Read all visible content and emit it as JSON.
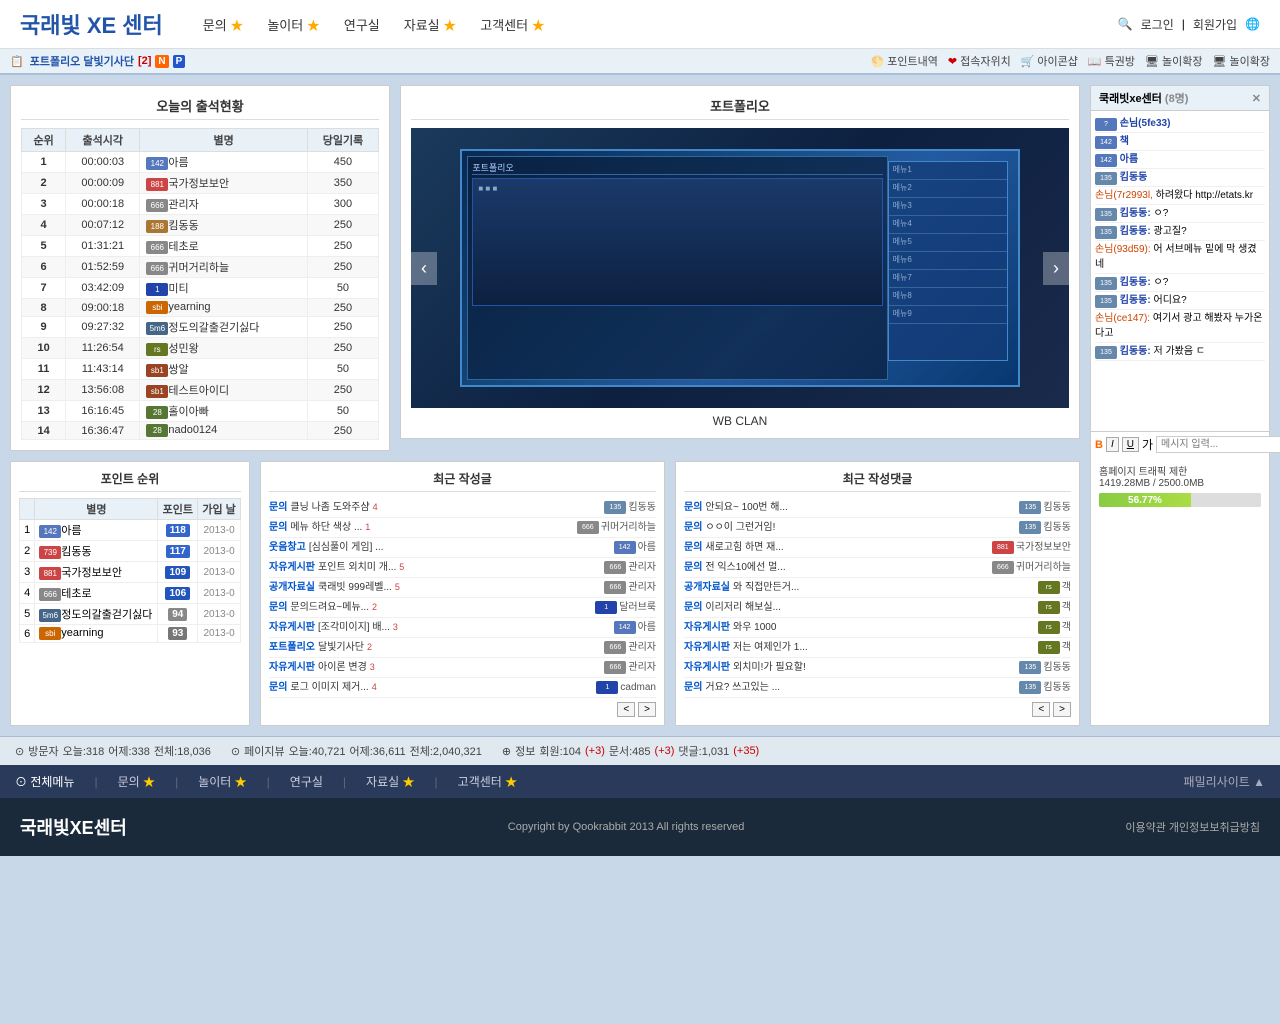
{
  "header": {
    "logo": "국래빛 XE 센터",
    "logo_xe": "XE",
    "nav": [
      {
        "label": "문의",
        "star": true
      },
      {
        "label": "놀이터",
        "star": true
      },
      {
        "label": "연구실",
        "star": false
      },
      {
        "label": "자료실",
        "star": true
      },
      {
        "label": "고객센터",
        "star": true
      }
    ],
    "right": [
      "검색",
      "로그인",
      "회원가입"
    ]
  },
  "tabbar": {
    "title": "포트폴리오 달빛기사단",
    "badge": "[2]",
    "items": [
      {
        "icon": "coin",
        "label": "포인트내역"
      },
      {
        "icon": "heart",
        "label": "접속자위치"
      },
      {
        "icon": "shop",
        "label": "아이콘샵"
      },
      {
        "icon": "book",
        "label": "특권방"
      },
      {
        "icon": "expand",
        "label": "놀이확장"
      },
      {
        "icon": "expand2",
        "label": "놀이확장"
      }
    ]
  },
  "attendance": {
    "title": "오늘의 출석현황",
    "headers": [
      "순위",
      "출석시각",
      "별명",
      "당일기록"
    ],
    "rows": [
      {
        "rank": "1",
        "time": "00:00:03",
        "badge": "142",
        "name": "아름",
        "score": "450"
      },
      {
        "rank": "2",
        "time": "00:00:09",
        "badge": "881",
        "name": "국가정보보안",
        "score": "350"
      },
      {
        "rank": "3",
        "time": "00:00:18",
        "badge": "666",
        "name": "관리자",
        "score": "300"
      },
      {
        "rank": "4",
        "time": "00:07:12",
        "badge": "188",
        "name": "킴동동",
        "score": "250"
      },
      {
        "rank": "5",
        "time": "01:31:21",
        "badge": "666",
        "name": "테초로",
        "score": "250"
      },
      {
        "rank": "6",
        "time": "01:52:59",
        "badge": "666",
        "name": "귀머거리하늘",
        "score": "250"
      },
      {
        "rank": "7",
        "time": "03:42:09",
        "badge": "1",
        "name": "미티",
        "score": "50"
      },
      {
        "rank": "8",
        "time": "09:00:18",
        "badge": "sbi",
        "name": "yearning",
        "score": "250"
      },
      {
        "rank": "9",
        "time": "09:27:32",
        "badge": "5m6",
        "name": "정도의갈출걷기싫다",
        "score": "250"
      },
      {
        "rank": "10",
        "time": "11:26:54",
        "badge": "rs",
        "name": "성민왕",
        "score": "250"
      },
      {
        "rank": "11",
        "time": "11:43:14",
        "badge": "sb1",
        "name": "쌍알",
        "score": "50"
      },
      {
        "rank": "12",
        "time": "13:56:08",
        "badge": "sb1",
        "name": "테스트아이디",
        "score": "250"
      },
      {
        "rank": "13",
        "time": "16:16:45",
        "badge": "28",
        "name": "홀이아빠",
        "score": "50"
      },
      {
        "rank": "14",
        "time": "16:36:47",
        "badge": "28",
        "name": "nado0124",
        "score": "250"
      }
    ]
  },
  "portfolio": {
    "title": "포트폴리오",
    "caption": "WB CLAN"
  },
  "points_ranking": {
    "title": "포인트 순위",
    "headers": [
      "별명",
      "포인트",
      "가입 날"
    ],
    "rows": [
      {
        "rank": "1",
        "badge": "142",
        "name": "아름",
        "points": "118",
        "date": "2013-0"
      },
      {
        "rank": "2",
        "badge": "739",
        "name": "킴동동",
        "points": "117",
        "date": "2013-0"
      },
      {
        "rank": "3",
        "badge": "881",
        "name": "국가정보보안",
        "points": "109",
        "date": "2013-0"
      },
      {
        "rank": "4",
        "badge": "666",
        "name": "테초로",
        "points": "106",
        "date": "2013-0"
      },
      {
        "rank": "5",
        "badge": "5m6",
        "name": "정도의갈출걷기싫다",
        "points": "94",
        "date": "2013-0"
      },
      {
        "rank": "6",
        "badge": "sbi",
        "name": "yearning",
        "points": "93",
        "date": "2013-0"
      }
    ]
  },
  "recent_posts": {
    "title": "최근 작성글",
    "items": [
      {
        "cat": "문의",
        "title": "클닝 나좀 도와주샴",
        "num": "4",
        "author": "킴동동",
        "badge": "135"
      },
      {
        "cat": "문의",
        "title": "메뉴 하단 색상 ...",
        "num": "1",
        "author": "귀머거리하늘",
        "badge": "666"
      },
      {
        "cat": "웃음창고",
        "title": "[심심풀이 게임] ...",
        "num": "",
        "author": "아름",
        "badge": "142"
      },
      {
        "cat": "자유게시판",
        "title": "포인트 외치미 개...",
        "num": "5",
        "author": "관리자",
        "badge": "666"
      },
      {
        "cat": "공개자료실",
        "title": "쿡래빗 999레벨...",
        "num": "5",
        "author": "관리자",
        "badge": "666"
      },
      {
        "cat": "문의",
        "title": "문의드려요~메뉴...",
        "num": "2",
        "author": "달러브룩",
        "badge": "1"
      },
      {
        "cat": "자유게시판",
        "title": "[조각미이지] 배...",
        "num": "3",
        "author": "아름",
        "badge": "142"
      },
      {
        "cat": "포트폴리오",
        "title": "달빛기사단",
        "num": "2",
        "author": "관리자",
        "badge": "666"
      },
      {
        "cat": "자유게시판",
        "title": "아이론 변경",
        "num": "3",
        "author": "관리자",
        "badge": "666"
      },
      {
        "cat": "문의",
        "title": "로그 이미지 제거...",
        "num": "4",
        "author": "cadman",
        "badge": "1"
      }
    ]
  },
  "recent_comments": {
    "title": "최근 작성댓글",
    "items": [
      {
        "cat": "문의",
        "title": "안되요~ 100번 해...",
        "author": "킴동동",
        "badge": "135"
      },
      {
        "cat": "문의",
        "title": "ㅇㅇ이 그런거임!",
        "author": "킴동동",
        "badge": "135"
      },
      {
        "cat": "문의",
        "title": "새로고힘 하면 재...",
        "author": "국가정보보안",
        "badge": "881"
      },
      {
        "cat": "문의",
        "title": "전 익스10에선 멀...",
        "author": "귀머거리하늘",
        "badge": "666"
      },
      {
        "cat": "공개자료실",
        "title": "와 직접만든거...",
        "author": "객",
        "badge": "rs"
      },
      {
        "cat": "문의",
        "title": "이리저리 해보실...",
        "author": "객",
        "badge": "rs"
      },
      {
        "cat": "자유게시판",
        "title": "와우 1000",
        "author": "객",
        "badge": "rs"
      },
      {
        "cat": "자유게시판",
        "title": "저는 여제인가 1...",
        "author": "객",
        "badge": "rs"
      },
      {
        "cat": "자유게시판",
        "title": "외치미!가 필요할!",
        "author": "킴동동",
        "badge": "135"
      },
      {
        "cat": "문의",
        "title": "거요? 쓰고있는 ...",
        "author": "킴동동",
        "badge": "135"
      }
    ]
  },
  "sidebar": {
    "title": "쿡래빗xe센터",
    "online_count": "(8명)",
    "chat_messages": [
      {
        "type": "user",
        "name": "손님(5fe33)",
        "badge": ""
      },
      {
        "type": "user",
        "name": "책",
        "badge": "142"
      },
      {
        "type": "user",
        "name": "아름",
        "badge": "142"
      },
      {
        "type": "user",
        "name": "킴동동",
        "badge": "135"
      },
      {
        "type": "guest",
        "prefix": "손님(7r2993l,",
        "text": "하려왔다 http://etats.kr"
      },
      {
        "type": "user",
        "name": "킴동동:",
        "badge": "135",
        "text": "ㅇ?"
      },
      {
        "type": "user",
        "name": "킴동동:",
        "badge": "135",
        "text": "광고질?"
      },
      {
        "type": "guest",
        "prefix": "손님(93d59):",
        "text": "어 서브메뉴 밑에 막 생겼네"
      },
      {
        "type": "user",
        "name": "킴동동:",
        "badge": "135",
        "text": "ㅇ?"
      },
      {
        "type": "user",
        "name": "킴동동:",
        "badge": "135",
        "text": "어디요?"
      },
      {
        "type": "guest",
        "prefix": "손님(ce147):",
        "text": "여기서 광고 해봤자 누가온다고"
      },
      {
        "type": "user",
        "name": "킴동동:",
        "badge": "135",
        "text": "저 가봤음 ㄷ"
      }
    ],
    "traffic_label": "홈페이지 트래픽 제한",
    "traffic_current": "1419.28MB",
    "traffic_total": "2500.0MB",
    "traffic_percent": "56.77%",
    "traffic_bar_width": "56.77"
  },
  "footer_stats": {
    "visitors_label": "방문자",
    "visitors_today": "오늘:318",
    "visitors_yesterday": "어제:338",
    "visitors_total": "전체:18,036",
    "pageview_label": "페이지뷰",
    "pageview_today": "오늘:40,721",
    "pageview_yesterday": "어제:36,611",
    "pageview_total": "전체:2,040,321",
    "info_label": "정보",
    "members": "회원:104",
    "members_plus": "(+3)",
    "docs": "문서:485",
    "docs_plus": "(+3)",
    "comments": "댓글:1,031",
    "comments_plus": "(+35)"
  },
  "bottom_nav": {
    "all_menu": "⊙ 전체메뉴",
    "items": [
      {
        "label": "문의",
        "star": true
      },
      {
        "label": "놀이터",
        "star": true
      },
      {
        "label": "연구실",
        "star": false
      },
      {
        "label": "자료실",
        "star": true
      },
      {
        "label": "고객센터",
        "star": true
      }
    ],
    "family_site": "패밀리사이트 ▲"
  },
  "page_footer": {
    "logo": "국래빛XE센터",
    "copyright": "Copyright by Qookrabbit 2013 All rights reserved",
    "terms": "이용약관 개인정보보취급방침"
  }
}
